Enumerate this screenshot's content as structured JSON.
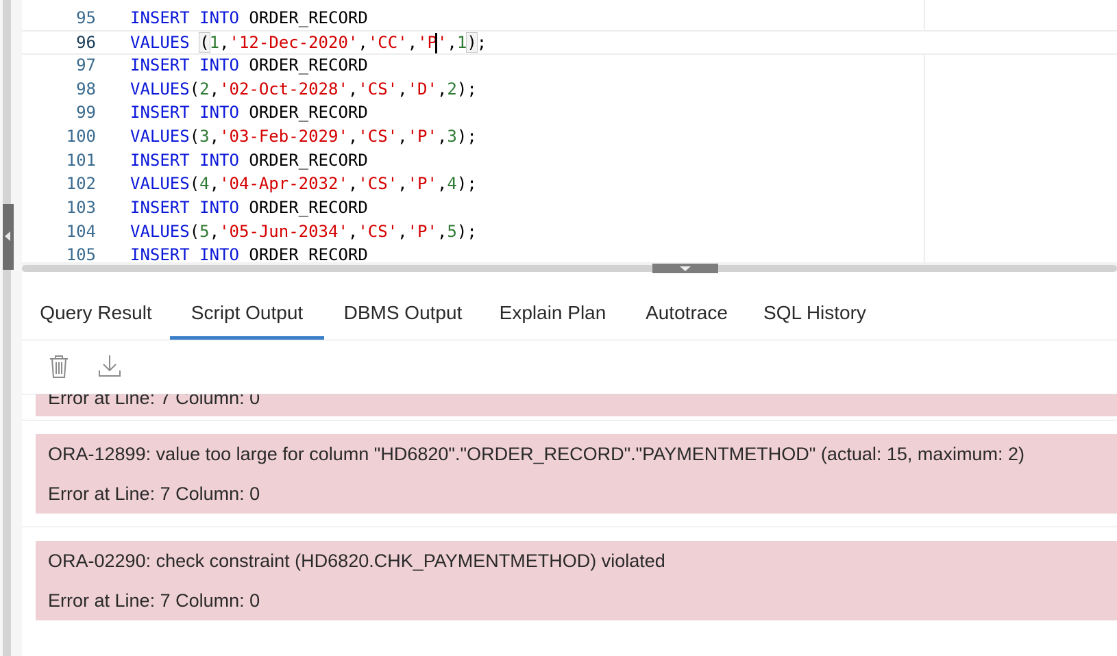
{
  "editor": {
    "lines": [
      {
        "num": "95",
        "tokens": [
          {
            "t": "INSERT",
            "c": "kw"
          },
          {
            "t": " ",
            "c": "plain"
          },
          {
            "t": "INTO",
            "c": "kw"
          },
          {
            "t": " ORDER_RECORD",
            "c": "plain"
          }
        ]
      },
      {
        "num": "96",
        "current": true,
        "tokens": [
          {
            "t": "VALUES",
            "c": "kw"
          },
          {
            "t": " ",
            "c": "plain"
          },
          {
            "t": "(",
            "c": "plain",
            "hl": true
          },
          {
            "t": "1",
            "c": "num"
          },
          {
            "t": ",",
            "c": "plain"
          },
          {
            "t": "'12-Dec-2020'",
            "c": "str"
          },
          {
            "t": ",",
            "c": "plain"
          },
          {
            "t": "'CC'",
            "c": "str"
          },
          {
            "t": ",",
            "c": "plain"
          },
          {
            "t": "'P",
            "c": "str"
          },
          {
            "t": "|",
            "c": "caret"
          },
          {
            "t": "'",
            "c": "str"
          },
          {
            "t": ",",
            "c": "plain"
          },
          {
            "t": "1",
            "c": "num"
          },
          {
            "t": ")",
            "c": "plain",
            "hl": true
          },
          {
            "t": ";",
            "c": "plain"
          }
        ]
      },
      {
        "num": "97",
        "tokens": [
          {
            "t": "INSERT",
            "c": "kw"
          },
          {
            "t": " ",
            "c": "plain"
          },
          {
            "t": "INTO",
            "c": "kw"
          },
          {
            "t": " ORDER_RECORD",
            "c": "plain"
          }
        ]
      },
      {
        "num": "98",
        "tokens": [
          {
            "t": "VALUES",
            "c": "kw"
          },
          {
            "t": "(",
            "c": "plain"
          },
          {
            "t": "2",
            "c": "num"
          },
          {
            "t": ",",
            "c": "plain"
          },
          {
            "t": "'02-Oct-2028'",
            "c": "str"
          },
          {
            "t": ",",
            "c": "plain"
          },
          {
            "t": "'CS'",
            "c": "str"
          },
          {
            "t": ",",
            "c": "plain"
          },
          {
            "t": "'D'",
            "c": "str"
          },
          {
            "t": ",",
            "c": "plain"
          },
          {
            "t": "2",
            "c": "num"
          },
          {
            "t": ");",
            "c": "plain"
          }
        ]
      },
      {
        "num": "99",
        "tokens": [
          {
            "t": "INSERT",
            "c": "kw"
          },
          {
            "t": " ",
            "c": "plain"
          },
          {
            "t": "INTO",
            "c": "kw"
          },
          {
            "t": " ORDER_RECORD",
            "c": "plain"
          }
        ]
      },
      {
        "num": "100",
        "tokens": [
          {
            "t": "VALUES",
            "c": "kw"
          },
          {
            "t": "(",
            "c": "plain"
          },
          {
            "t": "3",
            "c": "num"
          },
          {
            "t": ",",
            "c": "plain"
          },
          {
            "t": "'03-Feb-2029'",
            "c": "str"
          },
          {
            "t": ",",
            "c": "plain"
          },
          {
            "t": "'CS'",
            "c": "str"
          },
          {
            "t": ",",
            "c": "plain"
          },
          {
            "t": "'P'",
            "c": "str"
          },
          {
            "t": ",",
            "c": "plain"
          },
          {
            "t": "3",
            "c": "num"
          },
          {
            "t": ");",
            "c": "plain"
          }
        ]
      },
      {
        "num": "101",
        "tokens": [
          {
            "t": "INSERT",
            "c": "kw"
          },
          {
            "t": " ",
            "c": "plain"
          },
          {
            "t": "INTO",
            "c": "kw"
          },
          {
            "t": " ORDER_RECORD",
            "c": "plain"
          }
        ]
      },
      {
        "num": "102",
        "tokens": [
          {
            "t": "VALUES",
            "c": "kw"
          },
          {
            "t": "(",
            "c": "plain"
          },
          {
            "t": "4",
            "c": "num"
          },
          {
            "t": ",",
            "c": "plain"
          },
          {
            "t": "'04-Apr-2032'",
            "c": "str"
          },
          {
            "t": ",",
            "c": "plain"
          },
          {
            "t": "'CS'",
            "c": "str"
          },
          {
            "t": ",",
            "c": "plain"
          },
          {
            "t": "'P'",
            "c": "str"
          },
          {
            "t": ",",
            "c": "plain"
          },
          {
            "t": "4",
            "c": "num"
          },
          {
            "t": ");",
            "c": "plain"
          }
        ]
      },
      {
        "num": "103",
        "tokens": [
          {
            "t": "INSERT",
            "c": "kw"
          },
          {
            "t": " ",
            "c": "plain"
          },
          {
            "t": "INTO",
            "c": "kw"
          },
          {
            "t": " ORDER_RECORD",
            "c": "plain"
          }
        ]
      },
      {
        "num": "104",
        "tokens": [
          {
            "t": "VALUES",
            "c": "kw"
          },
          {
            "t": "(",
            "c": "plain"
          },
          {
            "t": "5",
            "c": "num"
          },
          {
            "t": ",",
            "c": "plain"
          },
          {
            "t": "'05-Jun-2034'",
            "c": "str"
          },
          {
            "t": ",",
            "c": "plain"
          },
          {
            "t": "'CS'",
            "c": "str"
          },
          {
            "t": ",",
            "c": "plain"
          },
          {
            "t": "'P'",
            "c": "str"
          },
          {
            "t": ",",
            "c": "plain"
          },
          {
            "t": "5",
            "c": "num"
          },
          {
            "t": ");",
            "c": "plain"
          }
        ]
      },
      {
        "num": "105",
        "tokens": [
          {
            "t": "INSERT",
            "c": "kw"
          },
          {
            "t": " ",
            "c": "plain"
          },
          {
            "t": "INTO",
            "c": "kw"
          },
          {
            "t": " ORDER_RECORD",
            "c": "plain"
          }
        ]
      }
    ]
  },
  "tabs": [
    {
      "label": "Query Result",
      "active": false
    },
    {
      "label": "Script Output",
      "active": true
    },
    {
      "label": "DBMS Output",
      "active": false
    },
    {
      "label": "Explain Plan",
      "active": false
    },
    {
      "label": "Autotrace",
      "active": false
    },
    {
      "label": "SQL History",
      "active": false
    }
  ],
  "toolbar": {
    "clear_icon": "trash-icon",
    "download_icon": "download-icon"
  },
  "output": {
    "partial_block": {
      "lines": [
        "Error at Line: 7 Column: 0"
      ]
    },
    "blocks": [
      {
        "lines": [
          "ORA-12899: value too large for column \"HD6820\".\"ORDER_RECORD\".\"PAYMENTMETHOD\" (actual: 15, maximum: 2)",
          "Error at Line: 7 Column: 0"
        ]
      },
      {
        "lines": [
          "ORA-02290: check constraint (HD6820.CHK_PAYMENTMETHOD) violated",
          "Error at Line: 7 Column: 0"
        ]
      }
    ]
  },
  "colors": {
    "keyword": "#0b18d8",
    "string": "#d40000",
    "number": "#2f7a33",
    "tab_active_underline": "#3a7fc9",
    "error_background": "#efd0d5"
  }
}
